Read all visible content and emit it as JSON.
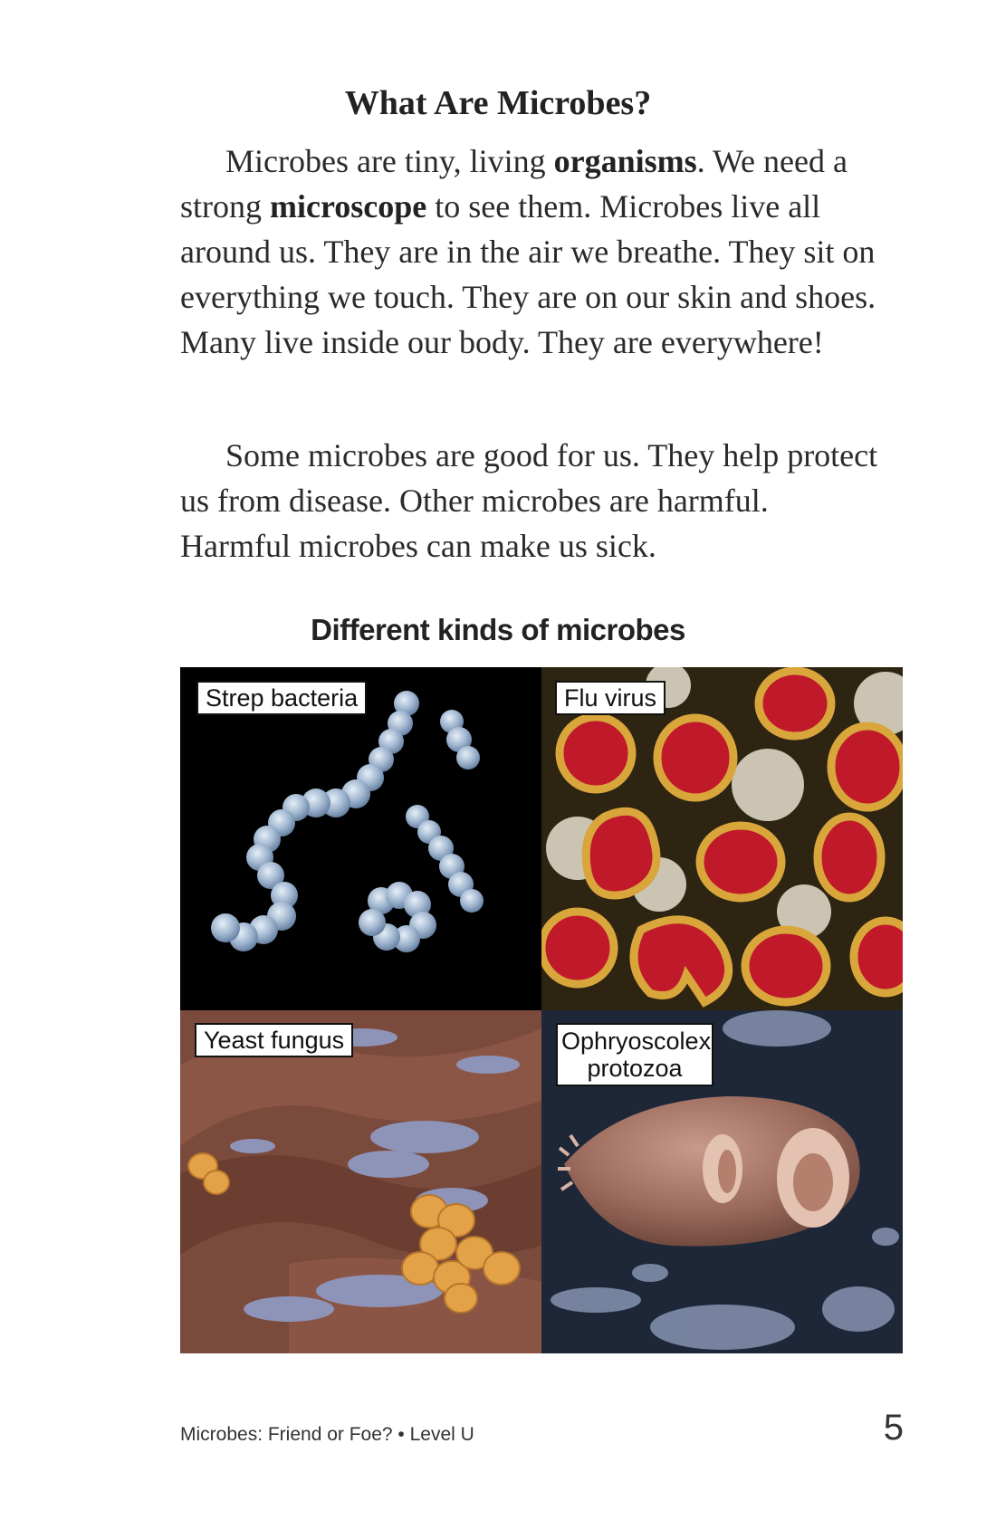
{
  "heading": "What Are Microbes?",
  "paragraph1": {
    "t1": "Microbes are tiny, living ",
    "b1": "organisms",
    "t2": ". We need a strong ",
    "b2": "microscope",
    "t3": " to see them. Microbes live all around us. They are in the air we breathe. They sit on everything we touch. They are on our skin and shoes. Many live inside our body. They are everywhere!"
  },
  "paragraph2": "Some microbes are good for us. They help protect us from disease. Other microbes are harmful. Harmful microbes can make us sick.",
  "figure": {
    "caption": "Different kinds of microbes",
    "images": [
      {
        "label": "Strep bacteria"
      },
      {
        "label": "Flu virus"
      },
      {
        "label": "Yeast fungus"
      },
      {
        "label": "Ophryoscolex protozoa"
      }
    ]
  },
  "footer": {
    "book_title": "Microbes: Friend or Foe? • Level U",
    "page_number": "5"
  }
}
